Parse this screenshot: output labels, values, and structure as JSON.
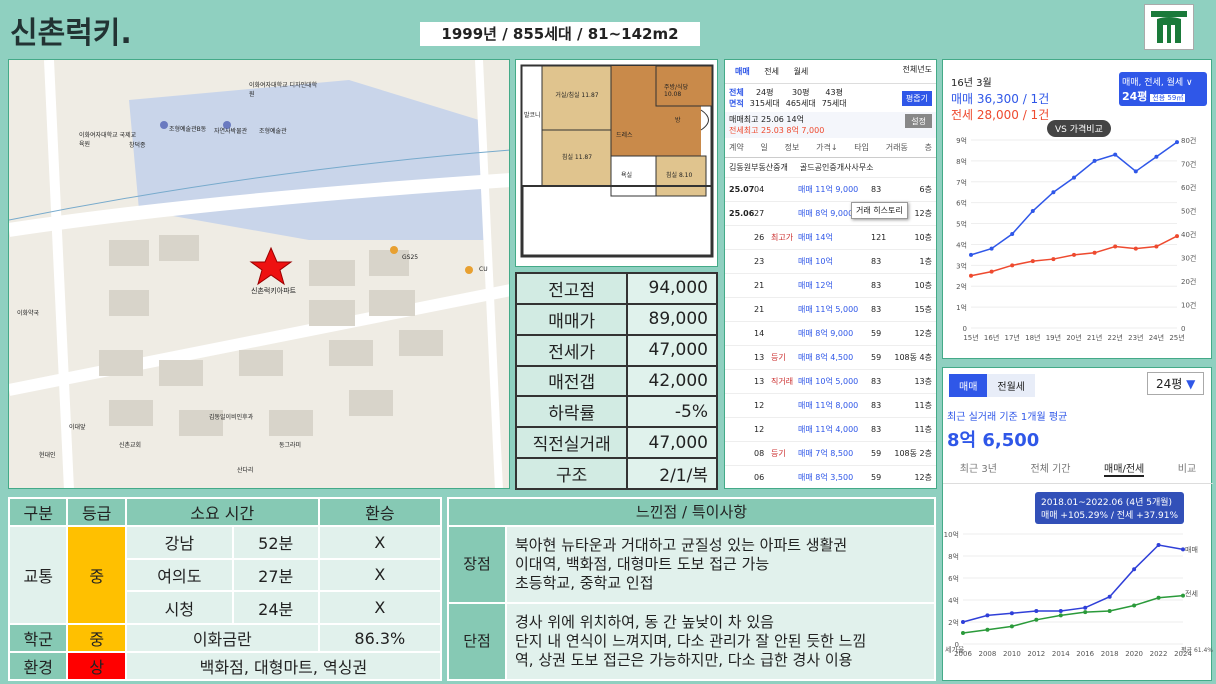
{
  "header": {
    "title": "신촌럭키.",
    "subtitle": "1999년 / 855세대 / 81~142m2"
  },
  "map": {
    "marker_label": "신촌럭키아파트",
    "labels": [
      "GS25",
      "CU",
      "이화여자대학교 디자인대학원",
      "이화여자대학교 국제교육원",
      "조형예술관",
      "조형예술관B동",
      "창덕종",
      "자연사박물관",
      "이화약국",
      "신촌교회",
      "김동일이비인후과",
      "이대앞",
      "현대인",
      "산다리",
      "동그라미"
    ]
  },
  "plan": {
    "rooms": [
      "거실/침실 11.87",
      "주방/식당 10.08",
      "방",
      "침실 11.87",
      "침실 8.10",
      "발코니",
      "드레스",
      "욕실"
    ]
  },
  "stats": [
    {
      "k": "전고점",
      "v": "94,000"
    },
    {
      "k": "매매가",
      "v": "89,000"
    },
    {
      "k": "전세가",
      "v": "47,000"
    },
    {
      "k": "매전갭",
      "v": "42,000"
    },
    {
      "k": "하락률",
      "v": "-5%"
    },
    {
      "k": "직전실거래",
      "v": "47,000"
    },
    {
      "k": "구조",
      "v": "2/1/복"
    }
  ],
  "deals": {
    "tabs": [
      "매매",
      "전세",
      "월세"
    ],
    "filter": "전체년도",
    "area_labels": [
      "전체",
      "24평",
      "30평",
      "43평"
    ],
    "households": [
      "315세대",
      "465세대",
      "75세대"
    ],
    "area_row_label": "면적",
    "btn_pyeong": "평줍기",
    "btn_setting": "설정",
    "max_sale": "매매최고 25.06 14억",
    "max_jeonse": "전세최고 25.03 8억 7,000",
    "cols": [
      "계약",
      "일",
      "정보",
      "가격↓",
      "타입",
      "거래동",
      "층"
    ],
    "agents": [
      "김동원부동산중개",
      "골드공인중개사사무소"
    ],
    "tooltip": "거래 히스토리",
    "rows": [
      {
        "ym": "25.07",
        "d": "04",
        "info": "",
        "p": "매매 11억 9,000",
        "t": "83",
        "f": "6층"
      },
      {
        "ym": "25.06",
        "d": "27",
        "info": "",
        "p": "매매 8억 9,000",
        "t": "59",
        "f": "12층"
      },
      {
        "ym": "",
        "d": "26",
        "info": "최고가",
        "p": "매매 14억",
        "t": "121",
        "f": "10층"
      },
      {
        "ym": "",
        "d": "23",
        "info": "",
        "p": "매매 10억",
        "t": "83",
        "f": "1층"
      },
      {
        "ym": "",
        "d": "21",
        "info": "",
        "p": "매매 12억",
        "t": "83",
        "f": "10층"
      },
      {
        "ym": "",
        "d": "21",
        "info": "",
        "p": "매매 11억 5,000",
        "t": "83",
        "f": "15층"
      },
      {
        "ym": "",
        "d": "14",
        "info": "",
        "p": "매매 8억 9,000",
        "t": "59",
        "f": "12층"
      },
      {
        "ym": "",
        "d": "13",
        "info": "등기",
        "p": "매매 8억 4,500",
        "t": "59",
        "f": "108동 4층"
      },
      {
        "ym": "",
        "d": "13",
        "info": "직거래",
        "p": "매매 10억 5,000",
        "t": "83",
        "f": "13층"
      },
      {
        "ym": "",
        "d": "12",
        "info": "",
        "p": "매매 11억 8,000",
        "t": "83",
        "f": "11층"
      },
      {
        "ym": "",
        "d": "12",
        "info": "",
        "p": "매매 11억 4,000",
        "t": "83",
        "f": "11층"
      },
      {
        "ym": "",
        "d": "08",
        "info": "등기",
        "p": "매매 7억 8,500",
        "t": "59",
        "f": "108동 2층"
      },
      {
        "ym": "",
        "d": "06",
        "info": "",
        "p": "매매 8억 3,500",
        "t": "59",
        "f": "12층"
      },
      {
        "ym": "",
        "d": "06",
        "info": "",
        "p": "매매 8억",
        "t": "59",
        "f": "1층"
      }
    ]
  },
  "chart1": {
    "date": "16년 3월",
    "sale": "매매 36,300 / 1건",
    "jeonse": "전세 28,000 / 1건",
    "badge_title": "매매, 전세, 월세 ∨",
    "badge_sub": "24평",
    "badge_area": "전용 59㎡",
    "compare": "VS 가격비교",
    "chart_data": {
      "type": "line",
      "x": [
        "15년",
        "16년",
        "17년",
        "18년",
        "19년",
        "20년",
        "21년",
        "22년",
        "23년",
        "24년",
        "25년"
      ],
      "series": [
        {
          "name": "매매",
          "values": [
            3.5,
            3.8,
            4.5,
            5.6,
            6.5,
            7.2,
            8.0,
            8.3,
            7.5,
            8.2,
            8.9
          ]
        },
        {
          "name": "전세",
          "values": [
            2.5,
            2.7,
            3.0,
            3.2,
            3.3,
            3.5,
            3.6,
            3.9,
            3.8,
            3.9,
            4.4
          ]
        }
      ],
      "yl": [
        "0",
        "1억",
        "2억",
        "3억",
        "4억",
        "5억",
        "6억",
        "7억",
        "8억",
        "9억"
      ],
      "yr": [
        "0",
        "10건",
        "20건",
        "30건",
        "40건",
        "50건",
        "60건",
        "70건",
        "80건"
      ]
    }
  },
  "chart2": {
    "tabs": [
      "매매",
      "전월세"
    ],
    "area": "24평",
    "subtitle": "최근 실거래 기준 1개월 평균",
    "price": "8억 6,500",
    "periods": [
      "최근 3년",
      "전체 기간",
      "매매/전세",
      "비교"
    ],
    "tooltip1": "2018.01~2022.06 (4년 5개월)",
    "tooltip2": "매매 +105.29% / 전세 +37.91%",
    "legend_sale": "매매",
    "legend_jeonse": "전세",
    "gap_label": "세가율",
    "avg_label": "평균 61.4%",
    "chart_data": {
      "type": "line",
      "x": [
        "2006",
        "2008",
        "2010",
        "2012",
        "2014",
        "2016",
        "2018",
        "2020",
        "2022",
        "2024"
      ],
      "series": [
        {
          "name": "매매",
          "values": [
            2.0,
            2.6,
            2.8,
            3.0,
            3.0,
            3.3,
            4.3,
            6.8,
            9.0,
            8.6
          ]
        },
        {
          "name": "전세",
          "values": [
            1.0,
            1.3,
            1.6,
            2.2,
            2.6,
            2.9,
            3.0,
            3.5,
            4.2,
            4.4
          ]
        }
      ],
      "yl": [
        "0",
        "2억",
        "4억",
        "6억",
        "8억",
        "10억"
      ]
    }
  },
  "grade": {
    "headers": [
      "구분",
      "등급",
      "소요 시간",
      "환승"
    ],
    "transport": "교통",
    "transport_grade": "중",
    "routes": [
      {
        "dest": "강남",
        "time": "52분",
        "x": "X"
      },
      {
        "dest": "여의도",
        "time": "27분",
        "x": "X"
      },
      {
        "dest": "시청",
        "time": "24분",
        "x": "X"
      }
    ],
    "school": "학군",
    "school_grade": "중",
    "school_name": "이화금란",
    "school_rate": "86.3%",
    "env": "환경",
    "env_grade": "상",
    "env_desc": "백화점, 대형마트, 역싱권",
    "colors": {
      "mid": "#ffc000",
      "high": "#ff0000"
    }
  },
  "notes": {
    "header": "느낀점 / 특이사항",
    "pros_label": "장점",
    "pros": [
      "북아현 뉴타운과 거대하고 균질성 있는 아파트 생활권",
      "이대역, 백화점, 대형마트 도보 접근 가능",
      "초등학교, 중학교 인접"
    ],
    "cons_label": "단점",
    "cons": [
      "경사 위에 위치하여, 동 간 높낮이 차 있음",
      "단지 내 연식이 느껴지며, 다소 관리가 잘 안된 듯한 느낌",
      "역, 상권 도보 접근은 가능하지만, 다소 급한 경사 이용"
    ]
  }
}
